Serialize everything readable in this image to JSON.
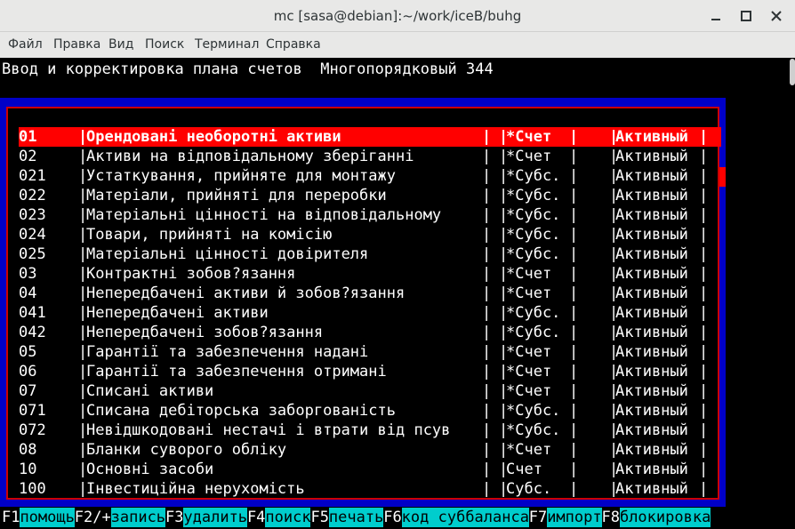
{
  "window": {
    "title": "mc [sasa@debian]:~/work/iceB/buhg"
  },
  "menu": [
    "Файл",
    "Правка",
    "Вид",
    "Поиск",
    "Терминал",
    "Справка"
  ],
  "terminal": {
    "heading": "Ввод и корректировка плана счетов  Многопорядковый 344"
  },
  "accounts": [
    {
      "code": "01",
      "name": "Орендовані необоротні активи",
      "type": "*Счет",
      "status": "Активный",
      "selected": true
    },
    {
      "code": "02",
      "name": "Активи на відповідальному зберіганні",
      "type": "*Счет",
      "status": "Активный"
    },
    {
      "code": "021",
      "name": "Устаткування, прийняте для монтажу",
      "type": "*Субс.",
      "status": "Активный"
    },
    {
      "code": "022",
      "name": "Матеріали, прийняті для переробки",
      "type": "*Субс.",
      "status": "Активный"
    },
    {
      "code": "023",
      "name": "Матеріальні цінності на відповідальному",
      "type": "*Субс.",
      "status": "Активный"
    },
    {
      "code": "024",
      "name": "Товари, прийняті на комісію",
      "type": "*Субс.",
      "status": "Активный"
    },
    {
      "code": "025",
      "name": "Матеріальні цінності довірителя",
      "type": "*Субс.",
      "status": "Активный"
    },
    {
      "code": "03",
      "name": "Контрактні зобов?язання",
      "type": "*Счет",
      "status": "Активный"
    },
    {
      "code": "04",
      "name": "Непередбачені активи й зобов?язання",
      "type": "*Счет",
      "status": "Активный"
    },
    {
      "code": "041",
      "name": "Непередбачені активи",
      "type": "*Субс.",
      "status": "Активный"
    },
    {
      "code": "042",
      "name": "Непередбачені зобов?язання",
      "type": "*Субс.",
      "status": "Активный"
    },
    {
      "code": "05",
      "name": "Гарантії та забезпечення надані",
      "type": "*Счет",
      "status": "Активный"
    },
    {
      "code": "06",
      "name": "Гарантії та забезпечення отримані",
      "type": "*Счет",
      "status": "Активный"
    },
    {
      "code": "07",
      "name": "Списані активи",
      "type": "*Счет",
      "status": "Активный"
    },
    {
      "code": "071",
      "name": "Списана дебіторська заборгованість",
      "type": "*Субс.",
      "status": "Активный"
    },
    {
      "code": "072",
      "name": "Невідшкодовані нестачі і втрати від псув",
      "type": "*Субс.",
      "status": "Активный"
    },
    {
      "code": "08",
      "name": "Бланки суворого обліку",
      "type": "*Счет",
      "status": "Активный"
    },
    {
      "code": "10",
      "name": "Основні засоби",
      "type": "Счет",
      "status": "Активный"
    },
    {
      "code": "100",
      "name": "Інвестиційна нерухомість",
      "type": "Субс.",
      "status": "Активный"
    }
  ],
  "function_keys": [
    {
      "key": "F1",
      "label": "помощь"
    },
    {
      "key": "F2/+",
      "label": "запись"
    },
    {
      "key": "F3",
      "label": "удалить"
    },
    {
      "key": "F4",
      "label": "поиск"
    },
    {
      "key": "F5",
      "label": "печать"
    },
    {
      "key": "F6",
      "label": "код суббаланса"
    },
    {
      "key": "F7",
      "label": "импорт"
    },
    {
      "key": "F8",
      "label": "блокировка"
    }
  ],
  "colors": {
    "selection": "#ff0000",
    "dialog_bg": "#0000c8",
    "fkey_label_bg": "#00cdcd"
  }
}
